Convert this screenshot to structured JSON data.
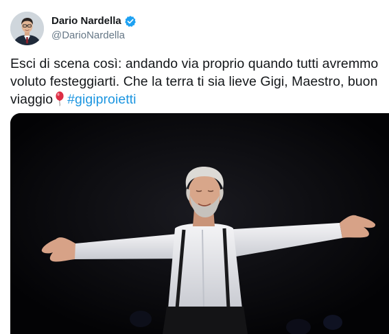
{
  "author": {
    "display_name": "Dario Nardella",
    "handle": "@DarioNardella",
    "verified": true,
    "avatar_icon": "person-avatar-icon",
    "verified_icon": "verified-badge-icon"
  },
  "tweet": {
    "text_main": "Esci di scena così: andando via proprio quando tutti avremmo voluto festeggiarti. Che la terra ti sia lieve Gigi, Maestro, buon viaggio",
    "emoji_icon": "red-balloon-icon",
    "hashtag": "#gigiproietti"
  },
  "media": {
    "type": "photo",
    "description_icon": "stage-photo-man-arms-outstretched"
  },
  "colors": {
    "link": "#1b95e0",
    "verified": "#1da1f2",
    "text": "#14171a",
    "secondary_text": "#657786"
  }
}
